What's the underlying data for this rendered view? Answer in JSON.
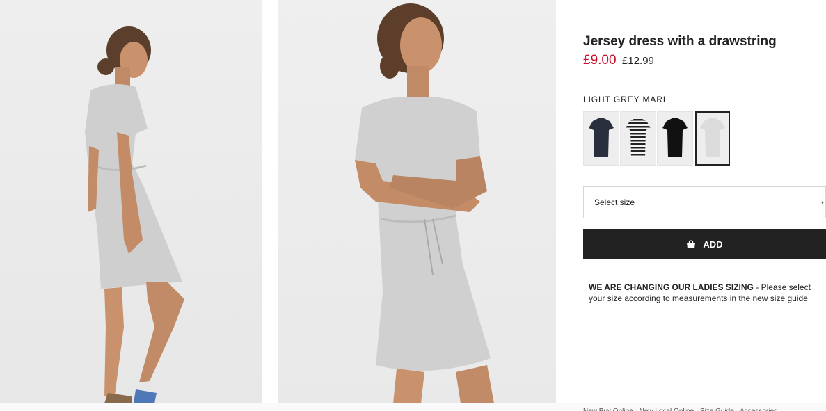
{
  "images": {
    "back_alt": "back-view-photo",
    "front_alt": "front-view-photo"
  },
  "product": {
    "title": "Jersey dress with a drawstring",
    "price_sale": "£9.00",
    "price_old": "£12.99",
    "color_name": "LIGHT GREY MARL"
  },
  "swatches": [
    {
      "name": "navy",
      "color": "#2a2f3d",
      "selected": false
    },
    {
      "name": "striped",
      "color": "#f4f4f4",
      "selected": false
    },
    {
      "name": "black",
      "color": "#111111",
      "selected": false
    },
    {
      "name": "light-grey-marl",
      "color": "#dcdcdc",
      "selected": true
    }
  ],
  "size_select": {
    "label": "Select size"
  },
  "add_button": {
    "label": "ADD"
  },
  "notice": {
    "bold": "WE ARE CHANGING OUR LADIES SIZING",
    "text": " - Please select your size according to measurements in the new size guide"
  },
  "footer": {
    "links": "New Buy Online · New Local Online · Size Guide · Accessories"
  },
  "colors": {
    "sale_red": "#c8102e",
    "button_black": "#222222"
  }
}
